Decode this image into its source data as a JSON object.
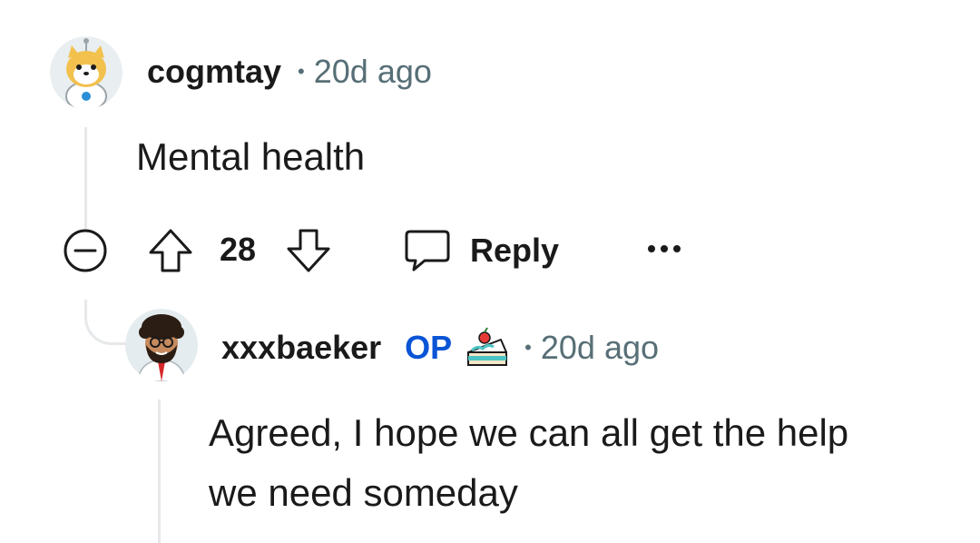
{
  "comments": [
    {
      "username": "cogmtay",
      "separator": "•",
      "time": "20d ago",
      "body": "Mental health",
      "avatar_icon": "doge-astronaut-avatar",
      "actions": {
        "collapse_icon": "minus-circle-icon",
        "upvote_icon": "arrow-up-icon",
        "score": "28",
        "downvote_icon": "arrow-down-icon",
        "reply_icon": "speech-bubble-icon",
        "reply_label": "Reply",
        "more_icon": "ellipsis-icon"
      }
    },
    {
      "username": "xxxbaeker",
      "op_badge": "OP",
      "flair_icon": "cake-slice-icon",
      "separator": "•",
      "time": "20d ago",
      "body_line1": "Agreed, I hope we can all get the help",
      "body_line2": "we need someday",
      "avatar_icon": "bearded-man-avatar"
    }
  ],
  "colors": {
    "text": "#1a1a1b",
    "meta": "#576f76",
    "op": "#0a54d6",
    "thread_line": "#e6e8ea"
  }
}
